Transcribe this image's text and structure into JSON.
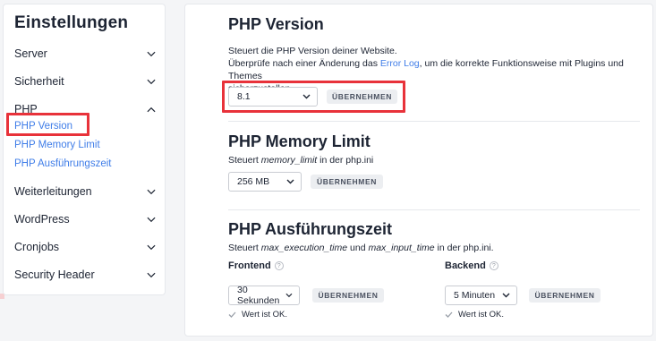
{
  "sidebar": {
    "title": "Einstellungen",
    "items": [
      {
        "label": "Server"
      },
      {
        "label": "Sicherheit"
      },
      {
        "label": "PHP"
      },
      {
        "label": "Weiterleitungen"
      },
      {
        "label": "WordPress"
      },
      {
        "label": "Cronjobs"
      },
      {
        "label": "Security Header"
      }
    ],
    "php_subitems": [
      {
        "label": "PHP Version"
      },
      {
        "label": "PHP Memory Limit"
      },
      {
        "label": "PHP Ausführungszeit"
      }
    ]
  },
  "php_version": {
    "title": "PHP Version",
    "desc_line1": "Steuert die PHP Version deiner Website.",
    "desc_line2_pre": "Überprüfe nach einer Änderung das ",
    "desc_link": "Error Log",
    "desc_line2_post": ", um die korrekte Funktionsweise mit Plugins und Themes",
    "desc_line3": "sicherzustellen.",
    "select_value": "8.1",
    "apply_label": "ÜBERNEHMEN"
  },
  "memory_limit": {
    "title": "PHP Memory Limit",
    "desc_pre": "Steuert ",
    "desc_em": "memory_limit",
    "desc_post": " in der php.ini",
    "select_value": "256 MB",
    "apply_label": "ÜBERNEHMEN"
  },
  "exec_time": {
    "title": "PHP Ausführungszeit",
    "desc_pre": "Steuert ",
    "desc_em1": "max_execution_time",
    "desc_mid": " und ",
    "desc_em2": "max_input_time",
    "desc_post": " in der php.ini.",
    "frontend": {
      "label": "Frontend",
      "select_value": "30 Sekunden",
      "apply_label": "ÜBERNEHMEN",
      "status": "Wert ist OK."
    },
    "backend": {
      "label": "Backend",
      "select_value": "5 Minuten",
      "apply_label": "ÜBERNEHMEN",
      "status": "Wert ist OK."
    }
  },
  "icons": {
    "chevron_down": "chevron-down-icon",
    "chevron_up": "chevron-up-icon",
    "help": "help-circle-icon",
    "check": "check-icon"
  },
  "colors": {
    "accent_link": "#3f7de8",
    "highlight": "#e8323a",
    "button_bg": "#eceef1"
  }
}
